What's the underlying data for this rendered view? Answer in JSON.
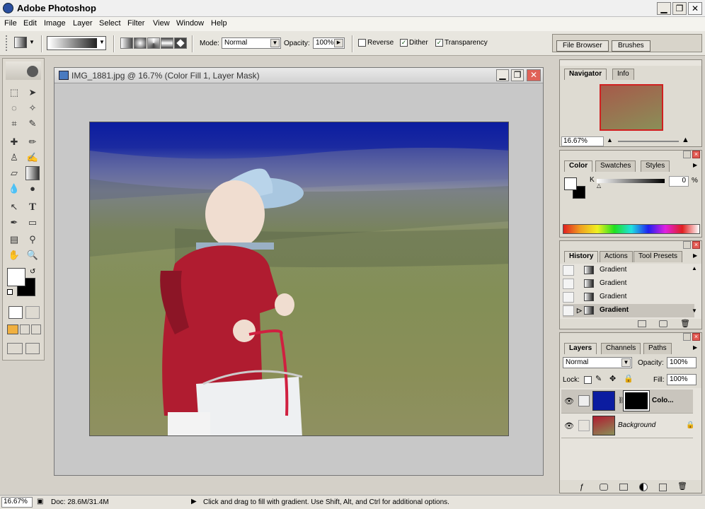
{
  "app": {
    "title": "Adobe Photoshop",
    "minimize": "▁",
    "restore": "❐",
    "close": "✕"
  },
  "menu": [
    "File",
    "Edit",
    "Image",
    "Layer",
    "Select",
    "Filter",
    "View",
    "Window",
    "Help"
  ],
  "options": {
    "mode_label": "Mode:",
    "mode_value": "Normal",
    "opacity_label": "Opacity:",
    "opacity_value": "100%",
    "reverse_label": "Reverse",
    "reverse_checked": false,
    "dither_label": "Dither",
    "dither_checked": true,
    "transparency_label": "Transparency",
    "transparency_checked": true,
    "check_glyph": "✓"
  },
  "palette_well": {
    "file_browser": "File Browser",
    "brushes": "Brushes"
  },
  "document": {
    "title": "IMG_1881.jpg @ 16.7% (Color Fill 1, Layer Mask)"
  },
  "navigator": {
    "tabs": [
      "Navigator",
      "Info"
    ],
    "zoom": "16.67%"
  },
  "color_panel": {
    "tabs": [
      "Color",
      "Swatches",
      "Styles"
    ],
    "channel": "K",
    "value": "0",
    "unit": "%"
  },
  "history_panel": {
    "tabs": [
      "History",
      "Actions",
      "Tool Presets"
    ],
    "items": [
      "Gradient",
      "Gradient",
      "Gradient",
      "Gradient"
    ]
  },
  "layers_panel": {
    "tabs": [
      "Layers",
      "Channels",
      "Paths"
    ],
    "blend_mode": "Normal",
    "opacity_label": "Opacity:",
    "opacity_value": "100%",
    "lock_label": "Lock:",
    "fill_label": "Fill:",
    "fill_value": "100%",
    "layers": [
      {
        "name": "Colo...",
        "italic": false
      },
      {
        "name": "Background",
        "italic": true
      }
    ]
  },
  "status": {
    "zoom": "16.67%",
    "doc": "Doc: 28.6M/31.4M",
    "message": "Click and drag to fill with gradient. Use Shift, Alt, and Ctrl for additional options."
  },
  "colors": {
    "canvas_sky": "#0b1ca0",
    "grass": "#868f5a",
    "jacket": "#b01c30",
    "cap": "#a9c7e0"
  }
}
